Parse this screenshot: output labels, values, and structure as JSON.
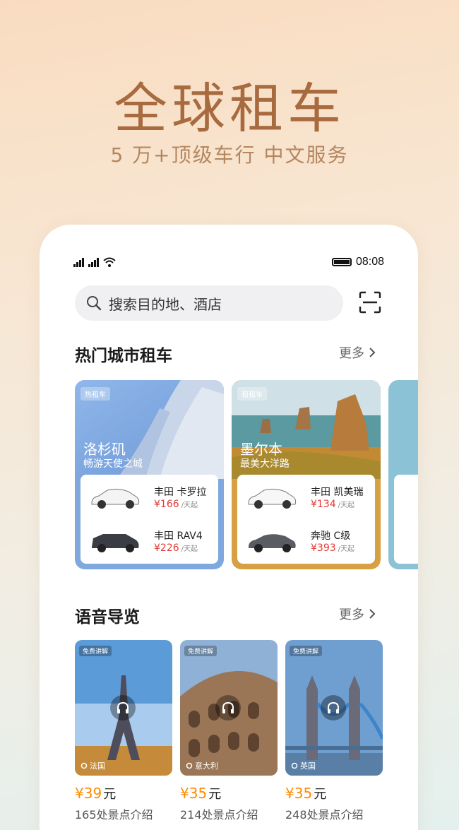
{
  "hero": {
    "title": "全球租车",
    "subtitle": "5 万+顶级车行 中文服务"
  },
  "status_bar": {
    "time": "08:08"
  },
  "search": {
    "placeholder": "搜索目的地、酒店"
  },
  "hot_cities": {
    "title": "热门城市租车",
    "more": "更多",
    "cards": [
      {
        "tag": "热租车",
        "name": "洛杉矶",
        "desc": "畅游天使之城",
        "cars": [
          {
            "name": "丰田 卡罗拉",
            "price": "¥166",
            "unit": "/天起"
          },
          {
            "name": "丰田 RAV4",
            "price": "¥226",
            "unit": "/天起"
          }
        ]
      },
      {
        "tag": "租租车",
        "name": "墨尔本",
        "desc": "最美大洋路",
        "cars": [
          {
            "name": "丰田 凯美瑞",
            "price": "¥134",
            "unit": "/天起"
          },
          {
            "name": "奔驰 C级",
            "price": "¥393",
            "unit": "/天起"
          }
        ]
      }
    ]
  },
  "audio_guide": {
    "title": "语音导览",
    "more": "更多",
    "items": [
      {
        "tag": "免费讲解",
        "country": "法国",
        "price": "¥39",
        "yuan": "元",
        "count": "165处景点介绍"
      },
      {
        "tag": "免费讲解",
        "country": "意大利",
        "price": "¥35",
        "yuan": "元",
        "count": "214处景点介绍"
      },
      {
        "tag": "免费讲解",
        "country": "英国",
        "price": "¥35",
        "yuan": "元",
        "count": "248处景点介绍"
      }
    ]
  },
  "icons": [
    "search-icon",
    "scan-icon",
    "chevron-right-icon",
    "headphone-icon",
    "location-icon",
    "wifi-icon",
    "battery-icon"
  ]
}
